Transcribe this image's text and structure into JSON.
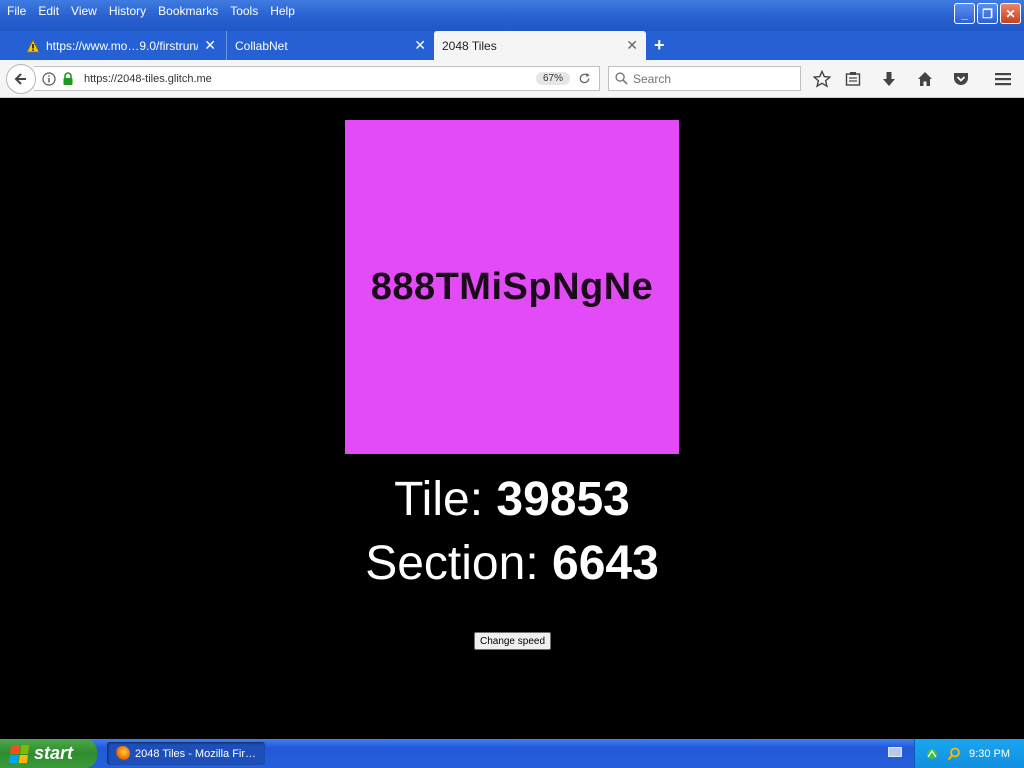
{
  "menu": [
    "File",
    "Edit",
    "View",
    "History",
    "Bookmarks",
    "Tools",
    "Help"
  ],
  "window_controls": {
    "minimize": "_",
    "restore": "❐",
    "close": "✕"
  },
  "tabs": [
    {
      "label": "https://www.mo…9.0/firstrun/",
      "close": "✕"
    },
    {
      "label": "CollabNet",
      "close": "✕"
    },
    {
      "label": "2048 Tiles",
      "close": "✕"
    }
  ],
  "new_tab": "+",
  "navbar": {
    "url": "https://2048-tiles.glitch.me",
    "zoom": "67%",
    "search_placeholder": "Search"
  },
  "page": {
    "tile_text": "888TMiSpNgNe",
    "tile_color": "#e44bf8",
    "tile_label": "Tile:",
    "tile_value": "39853",
    "section_label": "Section:",
    "section_value": "6643",
    "change_speed_label": "Change speed"
  },
  "taskbar": {
    "start_label": "start",
    "task_label": "2048 Tiles - Mozilla Fir…",
    "clock": "9:30 PM"
  }
}
